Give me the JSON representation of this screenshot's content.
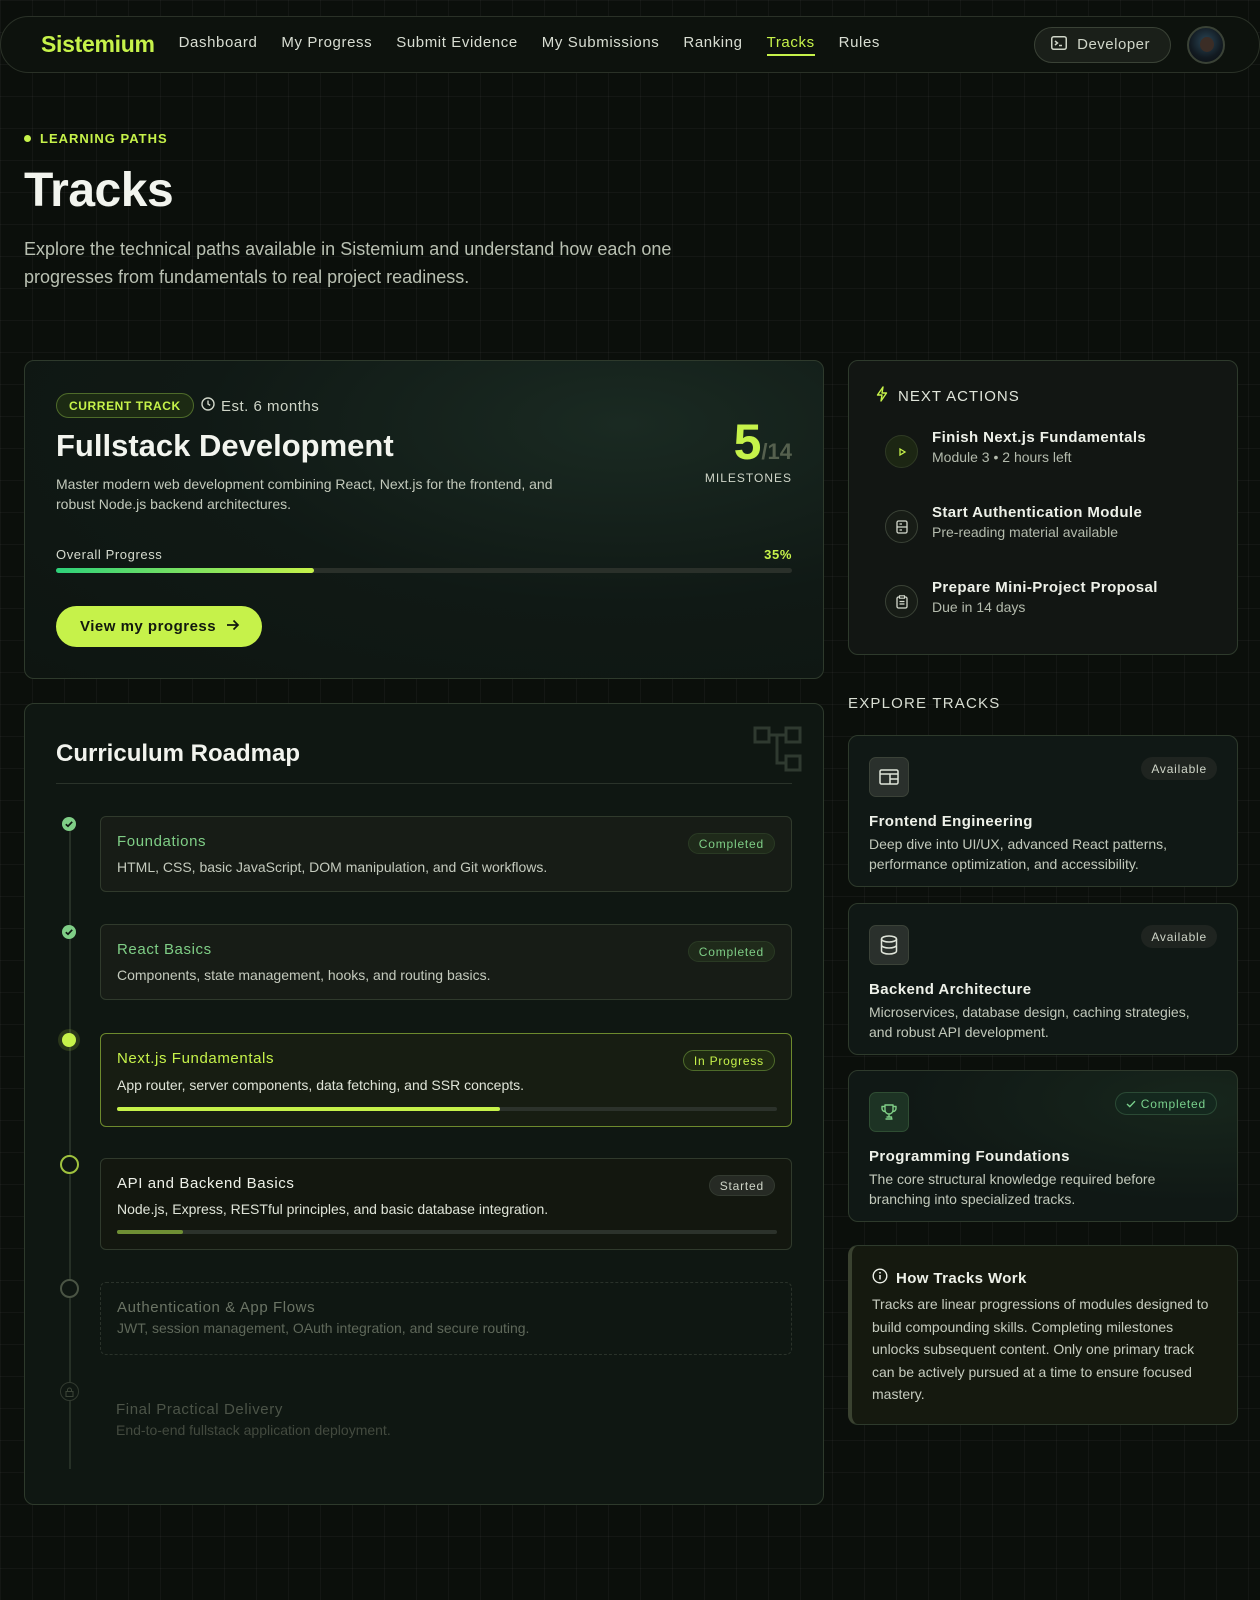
{
  "nav": {
    "logo": "Sistemium",
    "links": [
      "Dashboard",
      "My Progress",
      "Submit Evidence",
      "My Submissions",
      "Ranking",
      "Tracks",
      "Rules"
    ],
    "active": "Tracks",
    "role_button": "Developer",
    "role_icon": "terminal-icon"
  },
  "header": {
    "eyebrow": "LEARNING PATHS",
    "title": "Tracks",
    "description": "Explore the technical paths available in Sistemium and understand how each one progresses from fundamentals to real project readiness."
  },
  "current_track": {
    "badge": "CURRENT TRACK",
    "estimate": "Est. 6 months",
    "title": "Fullstack Development",
    "description": "Master modern web development combining React, Next.js for the frontend, and robust Node.js backend architectures.",
    "milestones_done": "5",
    "milestones_total": "/14",
    "milestones_label": "MILESTONES",
    "progress_label": "Overall Progress",
    "progress_percent_text": "35%",
    "progress_value": 0.35,
    "cta": "View my progress"
  },
  "roadmap": {
    "title": "Curriculum Roadmap",
    "items": [
      {
        "name": "Foundations",
        "desc": "HTML, CSS, basic JavaScript, DOM manipulation, and Git workflows.",
        "status": "Completed"
      },
      {
        "name": "React Basics",
        "desc": "Components, state management, hooks, and routing basics.",
        "status": "Completed"
      },
      {
        "name": "Next.js Fundamentals",
        "desc": "App router, server components, data fetching, and SSR concepts.",
        "status": "In Progress",
        "progress": 0.58
      },
      {
        "name": "API and Backend Basics",
        "desc": "Node.js, Express, RESTful principles, and basic database integration.",
        "status": "Started",
        "progress": 0.1
      },
      {
        "name": "Authentication & App Flows",
        "desc": "JWT, session management, OAuth integration, and secure routing.",
        "status": ""
      },
      {
        "name": "Final Practical Delivery",
        "desc": "End-to-end fullstack application deployment.",
        "status": ""
      }
    ]
  },
  "next_actions": {
    "title": "NEXT ACTIONS",
    "items": [
      {
        "title": "Finish Next.js Fundamentals",
        "sub": "Module 3 • 2 hours left",
        "icon": "play-icon"
      },
      {
        "title": "Start Authentication Module",
        "sub": "Pre-reading material available",
        "icon": "server-icon"
      },
      {
        "title": "Prepare Mini-Project Proposal",
        "sub": "Due in 14 days",
        "icon": "clipboard-icon"
      }
    ]
  },
  "explore": {
    "title": "EXPLORE TRACKS",
    "tracks": [
      {
        "name": "Frontend Engineering",
        "desc": "Deep dive into UI/UX, advanced React patterns, performance optimization, and accessibility.",
        "badge": "Available",
        "icon": "layout-icon"
      },
      {
        "name": "Backend Architecture",
        "desc": "Microservices, database design, caching strategies, and robust API development.",
        "badge": "Available",
        "icon": "database-icon"
      },
      {
        "name": "Programming Foundations",
        "desc": "The core structural knowledge required before branching into specialized tracks.",
        "badge": "Completed",
        "icon": "trophy-icon"
      }
    ]
  },
  "how": {
    "title": "How Tracks Work",
    "text": "Tracks are linear progressions of modules designed to build compounding skills. Completing milestones unlocks subsequent content. Only one primary track can be actively pursued at a time to ensure focused mastery."
  },
  "colors": {
    "accent": "#c6f24a",
    "completed": "#7fce86",
    "background": "#0b0f0b"
  }
}
